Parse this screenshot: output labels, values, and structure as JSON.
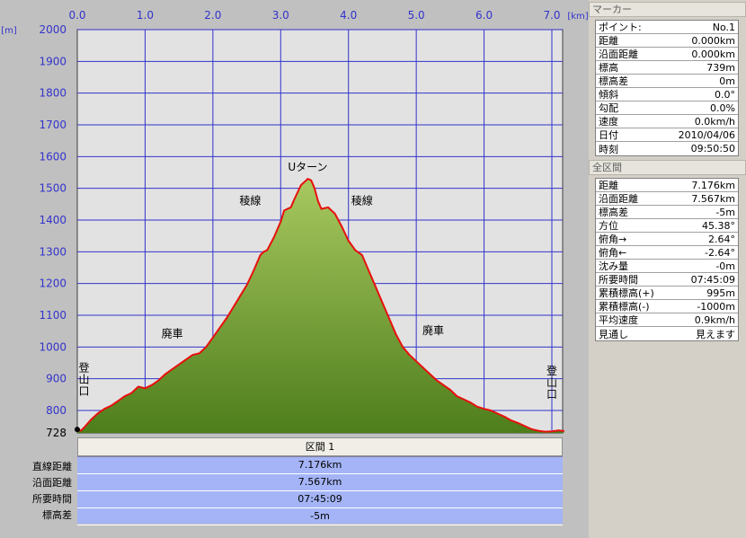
{
  "chart_data": {
    "type": "area",
    "x_unit": "[km]",
    "y_unit": "[m]",
    "xlim": [
      0.0,
      7.176
    ],
    "ylim": [
      728,
      2000
    ],
    "x_ticks": [
      "0.0",
      "1.0",
      "2.0",
      "3.0",
      "4.0",
      "5.0",
      "6.0",
      "7.0"
    ],
    "y_ticks": [
      "728",
      "800",
      "900",
      "1000",
      "1100",
      "1200",
      "1300",
      "1400",
      "1500",
      "1600",
      "1700",
      "1800",
      "1900",
      "2000"
    ],
    "grid": true,
    "series": [
      {
        "x": [
          0.0,
          0.05,
          0.1,
          0.2,
          0.3,
          0.4,
          0.5,
          0.6,
          0.7,
          0.8,
          0.9,
          1.0,
          1.1,
          1.2,
          1.3,
          1.4,
          1.5,
          1.6,
          1.7,
          1.8,
          1.9,
          2.0,
          2.1,
          2.2,
          2.3,
          2.4,
          2.5,
          2.6,
          2.7,
          2.75,
          2.8,
          2.9,
          3.0,
          3.05,
          3.1,
          3.15,
          3.2,
          3.3,
          3.4,
          3.45,
          3.5,
          3.55,
          3.6,
          3.7,
          3.8,
          3.9,
          4.0,
          4.1,
          4.2,
          4.3,
          4.4,
          4.5,
          4.6,
          4.7,
          4.8,
          4.9,
          5.0,
          5.1,
          5.2,
          5.3,
          5.4,
          5.5,
          5.6,
          5.7,
          5.8,
          5.9,
          6.0,
          6.1,
          6.2,
          6.3,
          6.4,
          6.5,
          6.6,
          6.7,
          6.8,
          6.9,
          7.0,
          7.1,
          7.176
        ],
        "y": [
          739,
          735,
          745,
          770,
          790,
          805,
          815,
          830,
          845,
          855,
          875,
          870,
          880,
          895,
          915,
          930,
          945,
          960,
          975,
          980,
          1000,
          1030,
          1060,
          1090,
          1125,
          1160,
          1195,
          1240,
          1290,
          1300,
          1305,
          1345,
          1395,
          1430,
          1435,
          1440,
          1465,
          1510,
          1530,
          1525,
          1500,
          1460,
          1435,
          1440,
          1420,
          1380,
          1335,
          1305,
          1290,
          1240,
          1190,
          1140,
          1090,
          1040,
          1000,
          975,
          955,
          935,
          915,
          895,
          880,
          865,
          845,
          835,
          825,
          812,
          805,
          800,
          790,
          780,
          768,
          760,
          750,
          740,
          735,
          732,
          733,
          736,
          734
        ]
      }
    ],
    "annotations": [
      {
        "text": "Uターン",
        "x": 3.4,
        "y": 1555
      },
      {
        "text": "稜線",
        "x": 2.55,
        "y": 1450
      },
      {
        "text": "稜線",
        "x": 4.2,
        "y": 1450
      },
      {
        "text": "廃車",
        "x": 1.4,
        "y": 1030
      },
      {
        "text": "廃車",
        "x": 5.25,
        "y": 1040
      },
      {
        "text": "登山口",
        "x": 0.1,
        "y": 900,
        "vertical": true
      },
      {
        "text": "登山口",
        "x": 7.0,
        "y": 890,
        "vertical": true
      }
    ],
    "fill_colors": [
      "#a8c860",
      "#4e7e1c"
    ],
    "line_color": "#e8100c",
    "plot_bg": "#e2e2e2",
    "grid_color": "#3333cc",
    "axis_label_color": "#3333cc"
  },
  "segment": {
    "tab_label": "区間 1",
    "rows": [
      {
        "label": "直線距離",
        "value": "7.176km"
      },
      {
        "label": "沿面距離",
        "value": "7.567km"
      },
      {
        "label": "所要時間",
        "value": "07:45:09"
      },
      {
        "label": "標高差",
        "value": "-5m"
      }
    ]
  },
  "marker": {
    "header": "マーカー",
    "rows": [
      {
        "label": "ポイント:",
        "value": "No.1"
      },
      {
        "label": "距離",
        "value": "0.000km"
      },
      {
        "label": "沿面距離",
        "value": "0.000km"
      },
      {
        "label": "標高",
        "value": "739m"
      },
      {
        "label": "標高差",
        "value": "0m"
      },
      {
        "label": "傾斜",
        "value": "0.0°"
      },
      {
        "label": "勾配",
        "value": "0.0%"
      },
      {
        "label": "速度",
        "value": "0.0km/h"
      },
      {
        "label": "日付",
        "value": "2010/04/06"
      },
      {
        "label": "時刻",
        "value": "09:50:50"
      }
    ]
  },
  "summary": {
    "header": "全区間",
    "rows": [
      {
        "label": "距離",
        "value": "7.176km"
      },
      {
        "label": "沿面距離",
        "value": "7.567km"
      },
      {
        "label": "標高差",
        "value": "-5m"
      },
      {
        "label": "方位",
        "value": "45.38°"
      },
      {
        "label": "俯角→",
        "value": "2.64°"
      },
      {
        "label": "俯角←",
        "value": "-2.64°"
      },
      {
        "label": "沈み量",
        "value": "-0m"
      },
      {
        "label": "所要時間",
        "value": "07:45:09"
      },
      {
        "label": "累積標高(+)",
        "value": "995m"
      },
      {
        "label": "累積標高(-)",
        "value": "-1000m"
      },
      {
        "label": "平均速度",
        "value": "0.9km/h"
      },
      {
        "label": "見通し",
        "value": "見えます"
      }
    ]
  }
}
